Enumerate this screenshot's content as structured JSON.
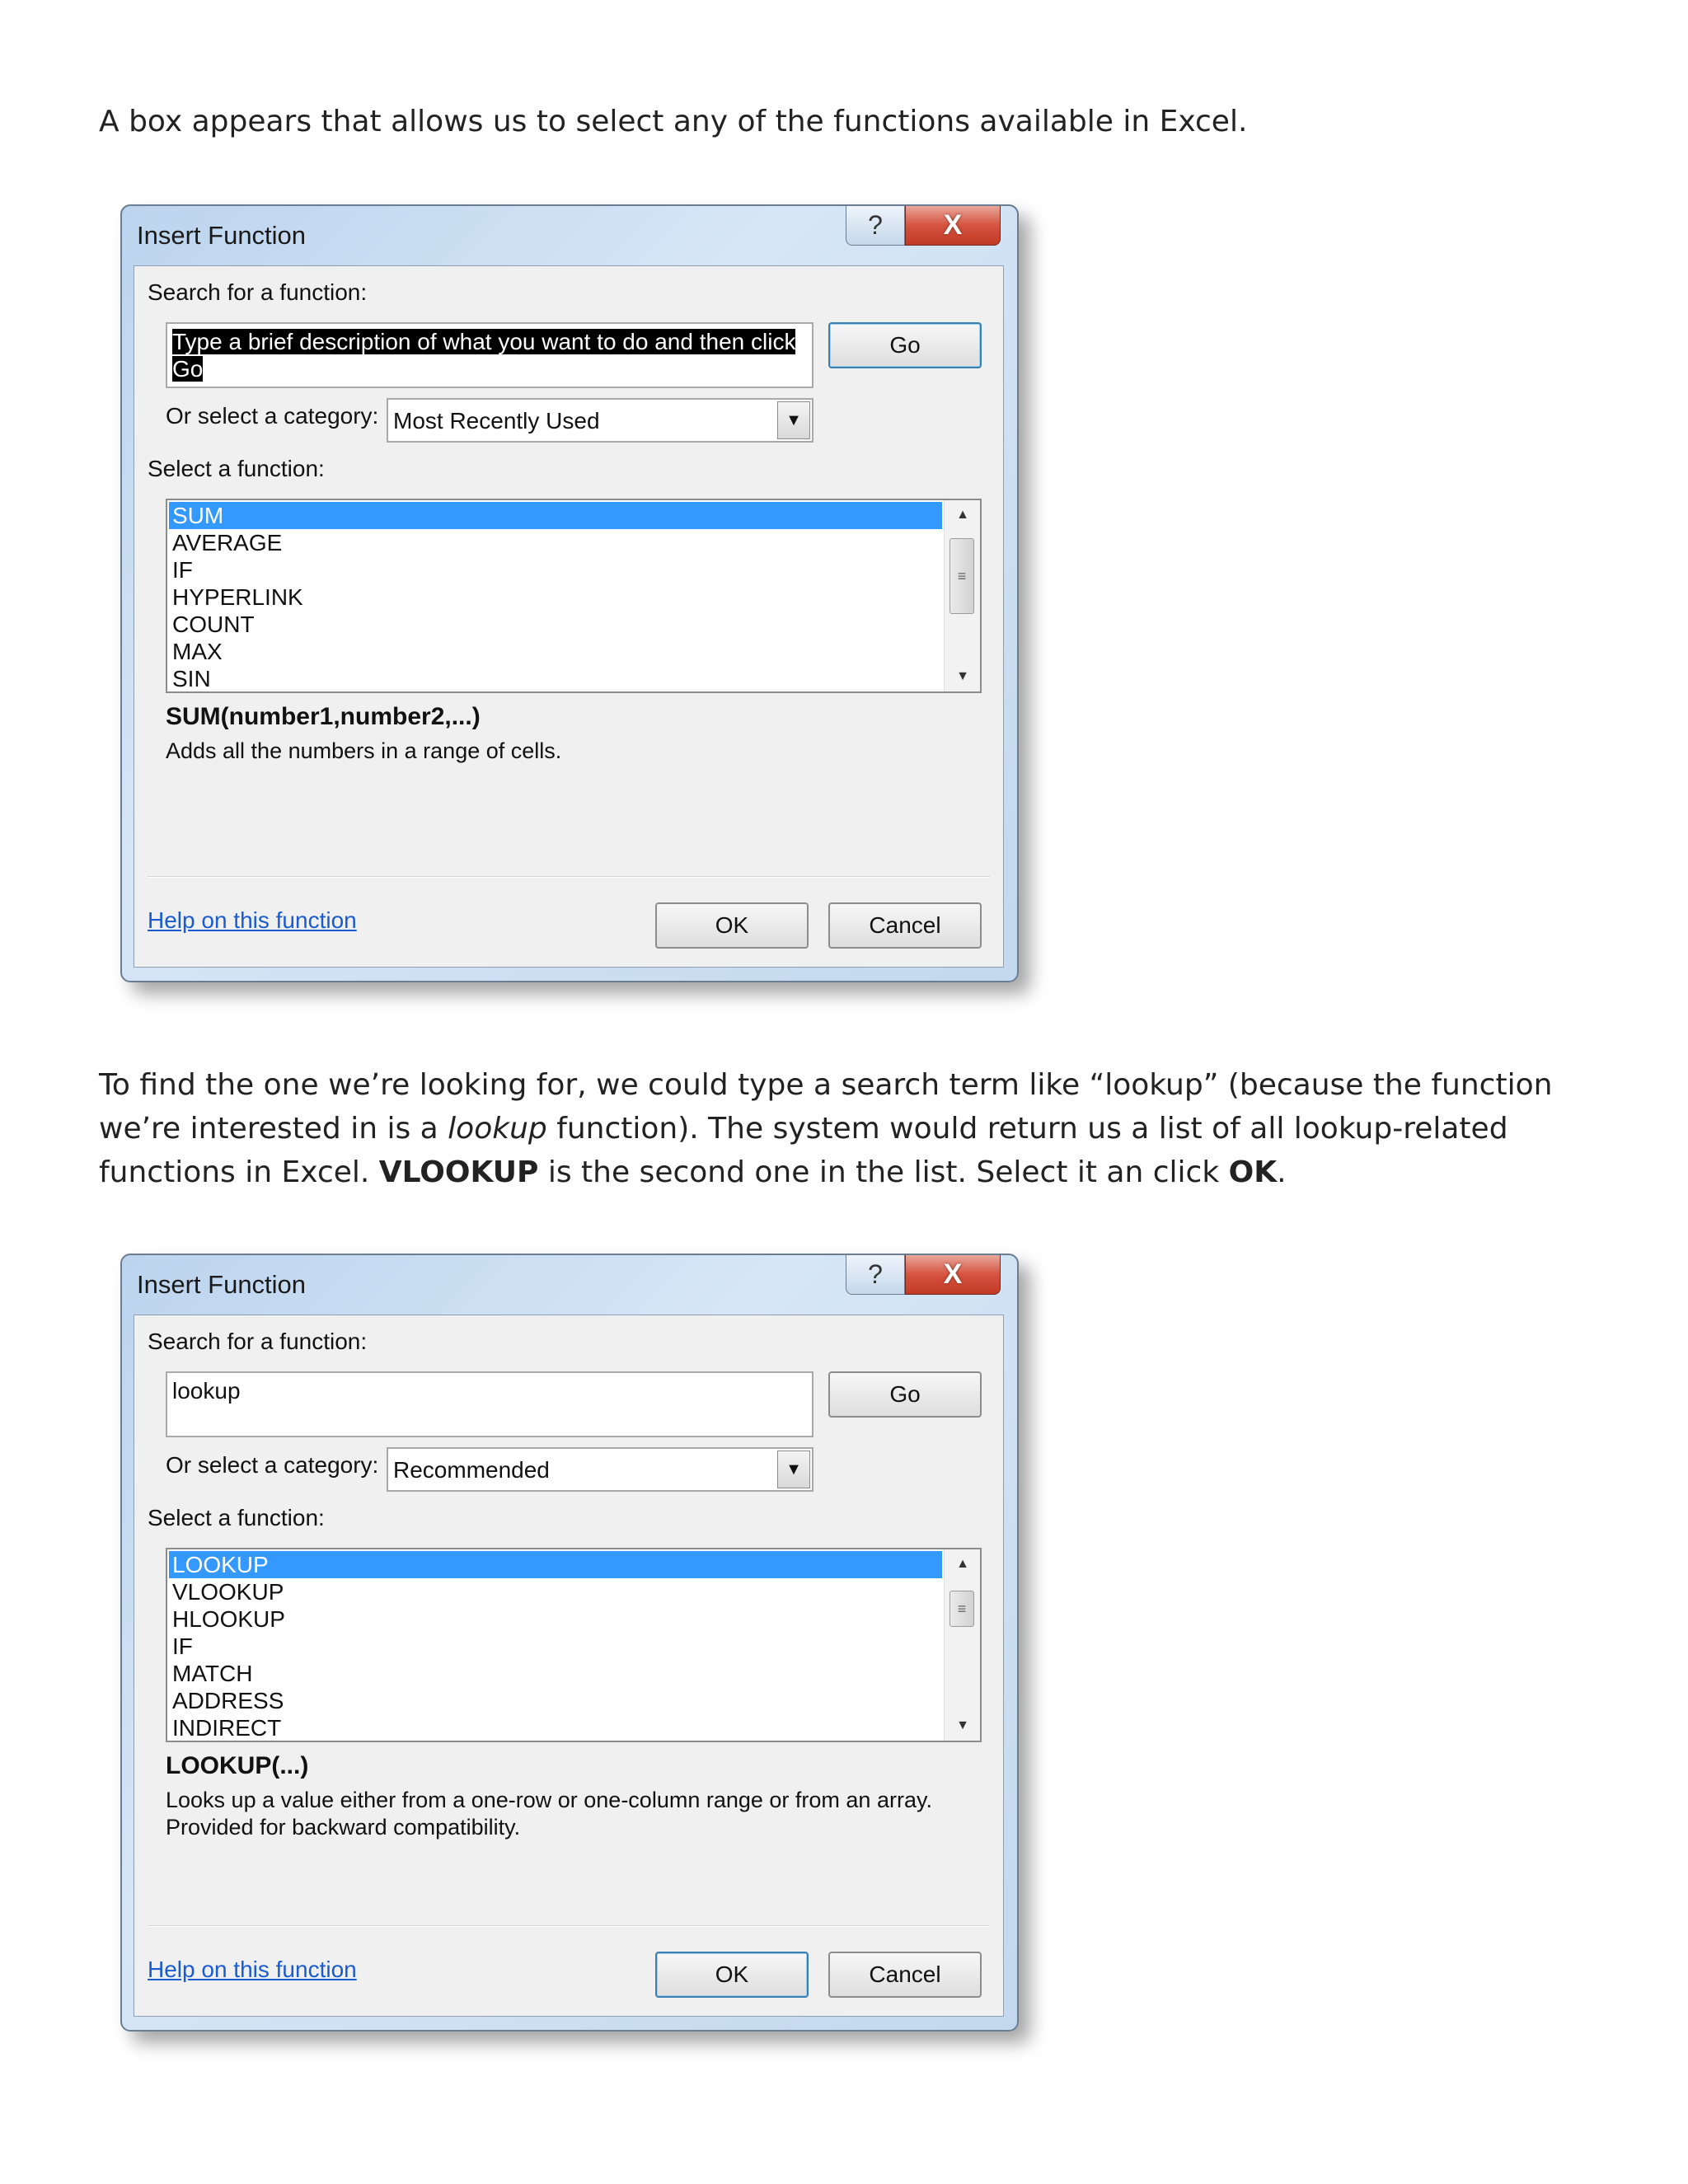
{
  "paragraph1": {
    "text": "A box appears that allows us to select any of the functions available in Excel."
  },
  "paragraph2": {
    "part1": "To find the one we’re looking for, we could type a search term like “lookup” (because the function we’re interested in is a ",
    "italic": "lookup",
    "part2": " function).  The system would return us a list of all lookup-related functions in Excel.  ",
    "bold1": "VLOOKUP",
    "part3": " is the second one in the list.  Select it an click ",
    "bold2": "OK",
    "part4": "."
  },
  "dialogs": [
    {
      "title": "Insert Function",
      "help_icon": "?",
      "close_icon": "X",
      "search_label": "Search for a function:",
      "search_value_line1": "Type a brief description of what you want to do and then click",
      "search_value_line2": "Go",
      "go_label": "Go",
      "category_label": "Or select a category:",
      "category_value": "Most Recently Used",
      "select_label": "Select a function:",
      "functions": [
        "SUM",
        "AVERAGE",
        "IF",
        "HYPERLINK",
        "COUNT",
        "MAX",
        "SIN"
      ],
      "selected_index": 0,
      "signature": "SUM(number1,number2,...)",
      "description": "Adds all the numbers in a range of cells.",
      "help_link": "Help on this function",
      "ok_label": "OK",
      "cancel_label": "Cancel"
    },
    {
      "title": "Insert Function",
      "help_icon": "?",
      "close_icon": "X",
      "search_label": "Search for a function:",
      "search_value": "lookup",
      "go_label": "Go",
      "category_label": "Or select a category:",
      "category_value": "Recommended",
      "select_label": "Select a function:",
      "functions": [
        "LOOKUP",
        "VLOOKUP",
        "HLOOKUP",
        "IF",
        "MATCH",
        "ADDRESS",
        "INDIRECT"
      ],
      "selected_index": 0,
      "signature": "LOOKUP(...)",
      "description": "Looks up a value either from a one-row or one-column range or from an array. Provided for backward compatibility.",
      "help_link": "Help on this function",
      "ok_label": "OK",
      "cancel_label": "Cancel"
    }
  ],
  "colors": {
    "selection": "#3399ff",
    "link": "#1a5ccf",
    "close_button": "#c9452f"
  }
}
